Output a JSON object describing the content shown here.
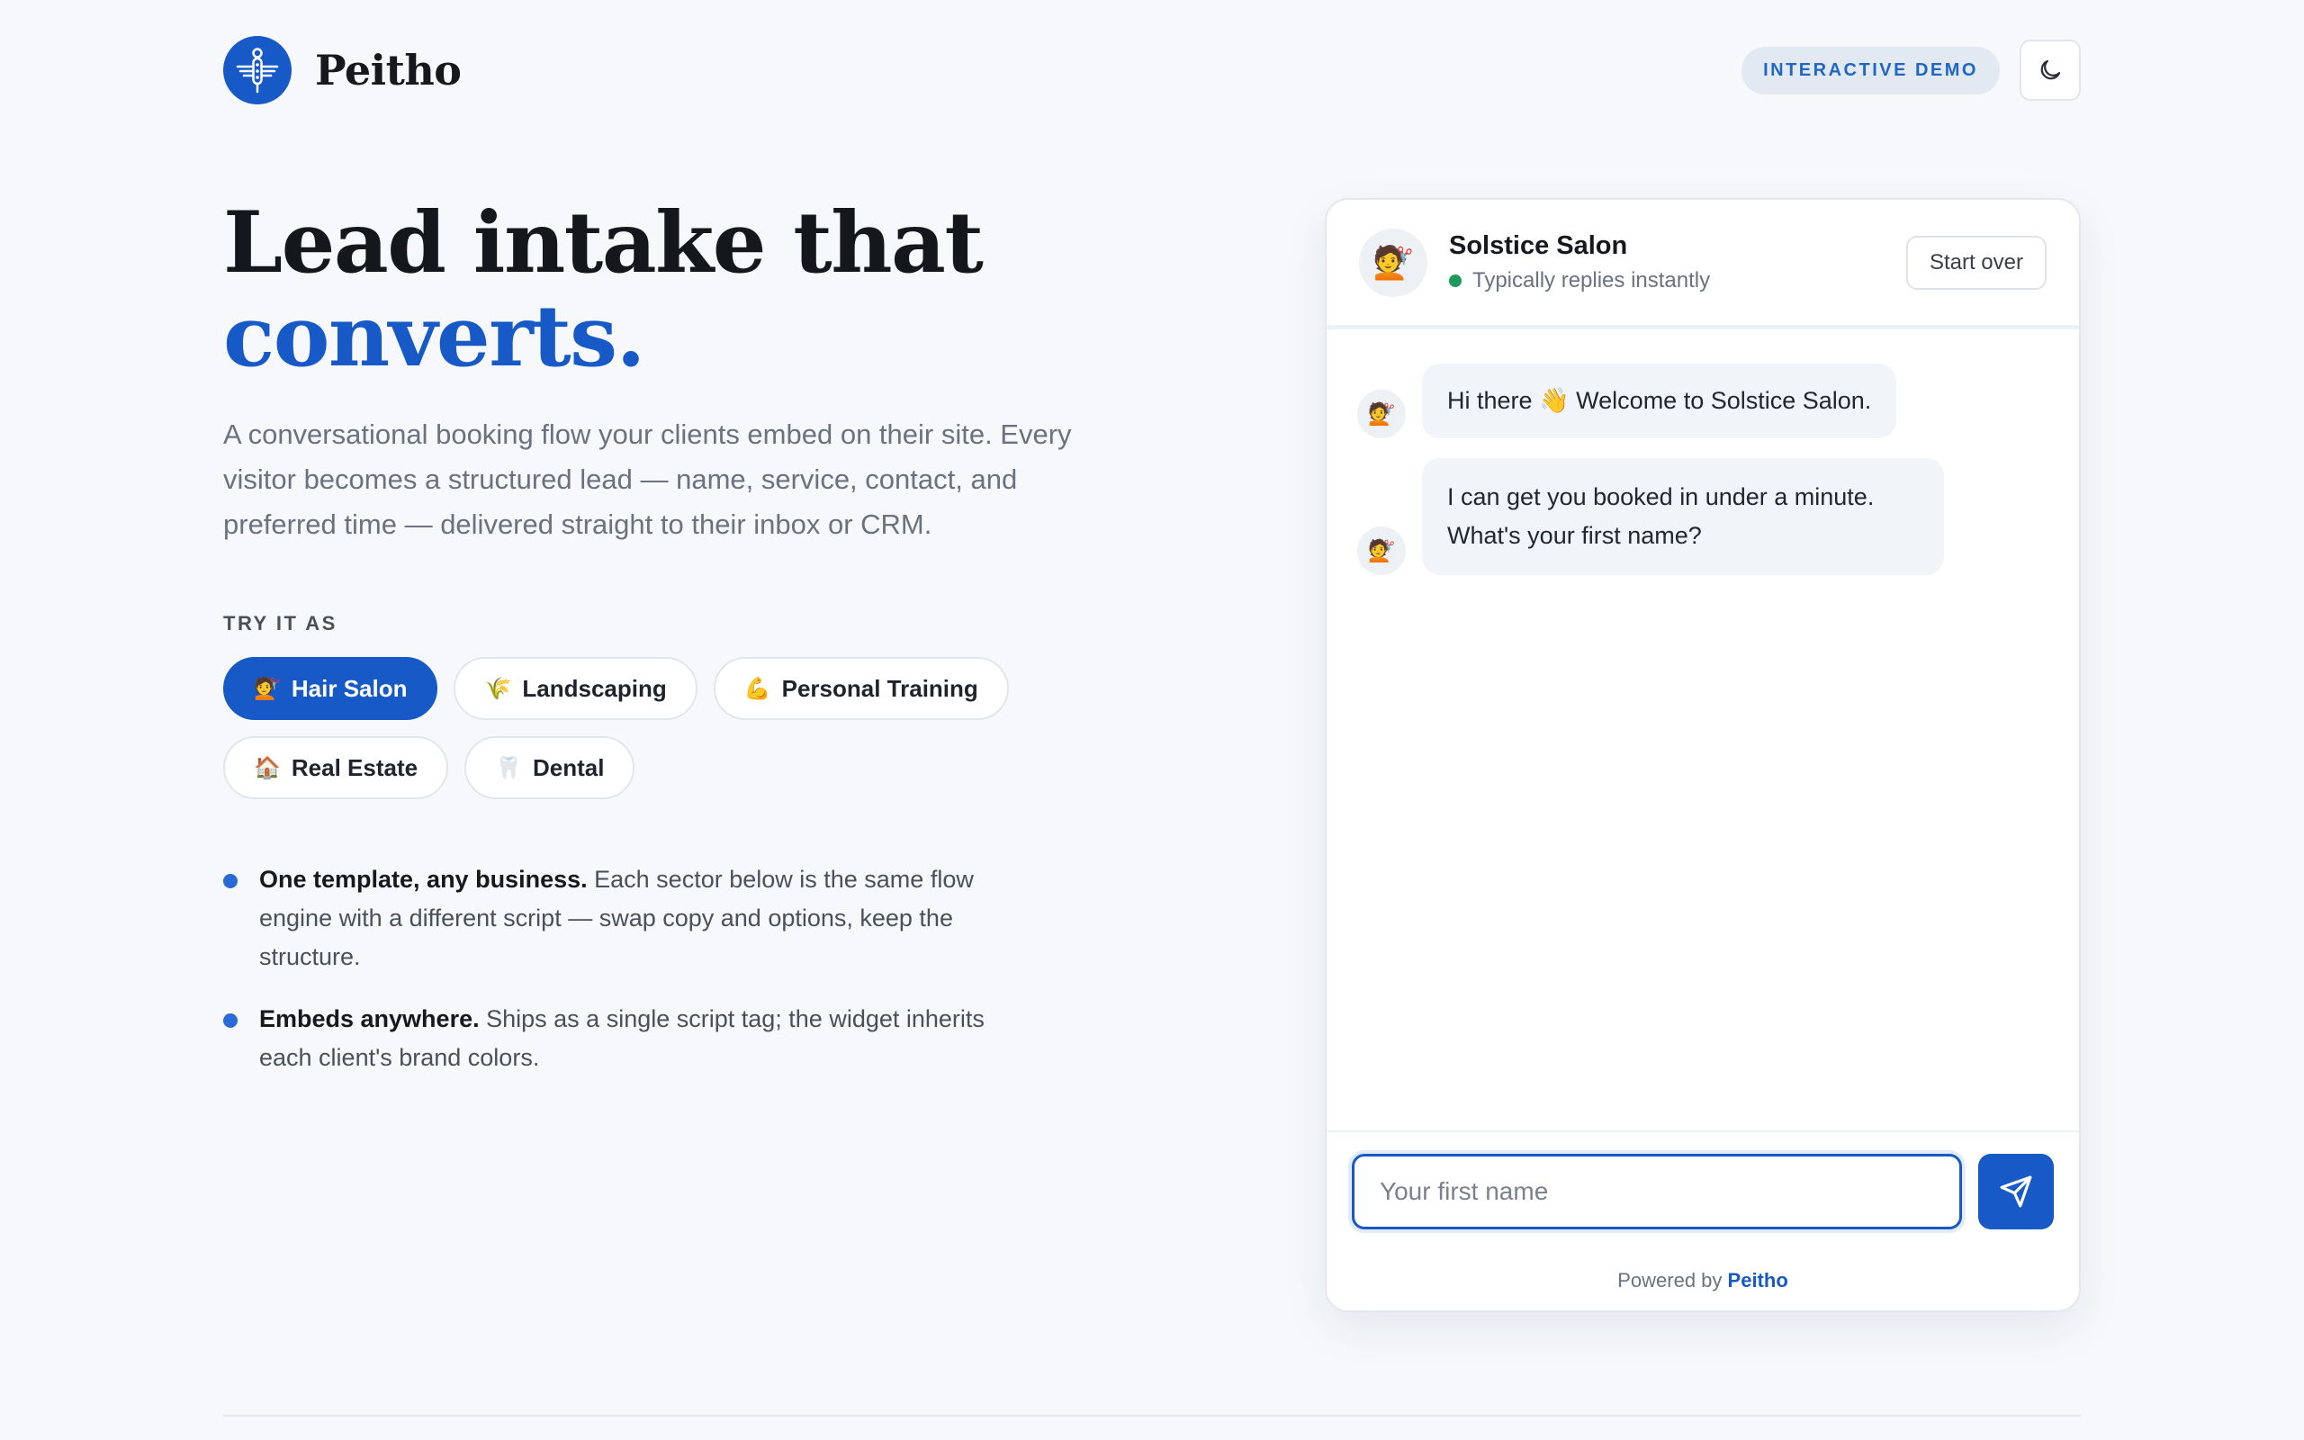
{
  "header": {
    "brand": "Peitho",
    "badge": "INTERACTIVE DEMO",
    "theme_icon": "moon-icon"
  },
  "hero": {
    "title_line1": "Lead intake that",
    "title_accent": "converts.",
    "subtitle": "A conversational booking flow your clients embed on their site. Every visitor becomes a structured lead — name, service, contact, and preferred time — delivered straight to their inbox or CRM.",
    "try_label": "TRY IT AS",
    "chips": [
      {
        "emoji": "💇",
        "label": "Hair Salon",
        "active": true
      },
      {
        "emoji": "🌾",
        "label": "Landscaping",
        "active": false
      },
      {
        "emoji": "💪",
        "label": "Personal Training",
        "active": false
      },
      {
        "emoji": "🏠",
        "label": "Real Estate",
        "active": false
      },
      {
        "emoji": "🦷",
        "label": "Dental",
        "active": false
      }
    ],
    "bullets": [
      {
        "bold": "One template, any business.",
        "text": "Each sector below is the same flow engine with a different script — swap copy and options, keep the structure."
      },
      {
        "bold": "Embeds anywhere.",
        "text": "Ships as a single script tag; the widget inherits each client's brand colors."
      }
    ]
  },
  "chat": {
    "avatar_emoji": "💇",
    "name": "Solstice Salon",
    "status": "Typically replies instantly",
    "start_over": "Start over",
    "messages": [
      {
        "text": "Hi there 👋 Welcome to Solstice Salon."
      },
      {
        "text": "I can get you booked in under a minute. What's your first name?"
      }
    ],
    "input_placeholder": "Your first name",
    "send_icon": "send-icon",
    "powered_prefix": "Powered by",
    "powered_link": "Peitho"
  },
  "colors": {
    "accent": "#1659c7",
    "background": "#f6f8fb",
    "status_online": "#1f9a5a"
  }
}
